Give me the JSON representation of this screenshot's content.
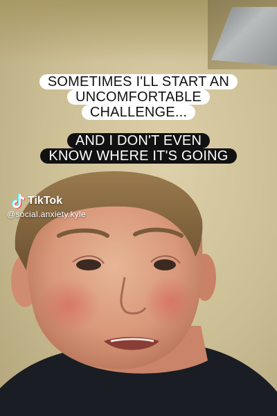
{
  "captions": {
    "top_lines": [
      "SOMETIMES I'LL START AN",
      "UNCOMFORTABLE",
      "CHALLENGE..."
    ],
    "bottom_lines": [
      "AND I DON'T EVEN",
      "KNOW WHERE IT'S GOING"
    ]
  },
  "watermark": {
    "brand": "TikTok",
    "username": "@social.anxiety.kyle",
    "logo_icon": "tiktok-note-icon"
  },
  "colors": {
    "caption_white_bg": "#ffffff",
    "caption_black_bg": "#111111",
    "wall": "#cfc29b",
    "shirt": "#1a1d24",
    "hair": "#8a6a42"
  }
}
